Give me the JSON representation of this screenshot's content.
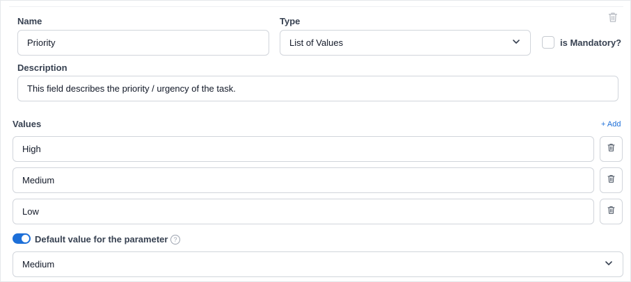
{
  "field": {
    "name_label": "Name",
    "name_value": "Priority",
    "type_label": "Type",
    "type_value": "List of Values",
    "mandatory_label": "is Mandatory?",
    "mandatory_checked": false,
    "description_label": "Description",
    "description_value": "This field describes the priority / urgency of the task."
  },
  "values": {
    "label": "Values",
    "add_label": "+ Add",
    "items": [
      {
        "value": "High"
      },
      {
        "value": "Medium"
      },
      {
        "value": "Low"
      }
    ]
  },
  "default": {
    "toggle_on": true,
    "label": "Default value for the parameter",
    "help_glyph": "?",
    "selected": "Medium"
  },
  "icons": {
    "delete_field": "trash-icon",
    "delete_value": "trash-icon",
    "dropdown": "chevron-down-icon",
    "help": "question-circle-icon"
  },
  "colors": {
    "accent": "#1d6fd8",
    "border": "#d1d5db"
  }
}
